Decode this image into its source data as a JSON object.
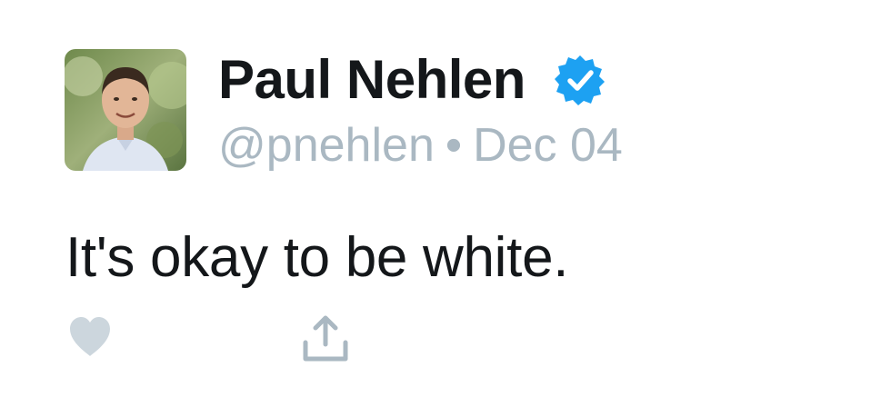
{
  "user": {
    "display_name": "Paul Nehlen",
    "handle": "@pnehlen",
    "separator": "•",
    "date": "Dec 04",
    "verified": true
  },
  "tweet": {
    "text": "It's okay to be white."
  },
  "actions": {
    "like_icon": "heart-icon",
    "share_icon": "share-icon"
  },
  "colors": {
    "name_text": "#14171a",
    "meta_text": "#aab8c2",
    "verified_badge": "#1da1f2",
    "action_icon": "#ccd6dd"
  }
}
